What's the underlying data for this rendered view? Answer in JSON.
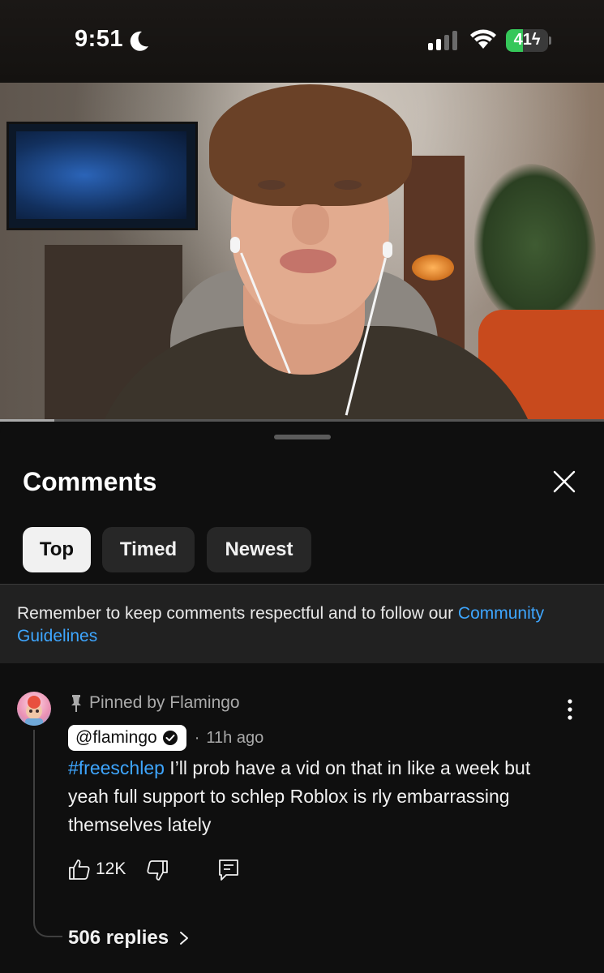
{
  "status_bar": {
    "time": "9:51",
    "focus_icon": "moon-icon",
    "signal_icon": "cellular-signal-icon",
    "wifi_icon": "wifi-icon",
    "battery_level": "41",
    "battery_charging": true,
    "battery_color": "#35c759"
  },
  "video": {
    "progress_fraction": 0.09
  },
  "comments_panel": {
    "title": "Comments",
    "close_icon": "close-icon",
    "tabs": [
      {
        "label": "Top",
        "active": true
      },
      {
        "label": "Timed",
        "active": false
      },
      {
        "label": "Newest",
        "active": false
      }
    ],
    "notice": {
      "text": "Remember to keep comments respectful and to follow our ",
      "link": "Community Guidelines"
    }
  },
  "pinned_comment": {
    "pinned_label": "Pinned by Flamingo",
    "author": "@flamingo",
    "verified": true,
    "separator": "·",
    "time_ago": "11h ago",
    "hashtag": "#freeschlep",
    "text": " I’ll prob have a vid on that in like a week but yeah full support to schlep Roblox is rly embarrassing themselves lately",
    "likes": "12K",
    "replies_label": "506 replies"
  },
  "colors": {
    "background": "#0f0f0f",
    "link_blue": "#3ea6ff",
    "chip_bg": "#272727",
    "chip_active_bg": "#f1f1f1",
    "notice_bg": "#212121"
  }
}
